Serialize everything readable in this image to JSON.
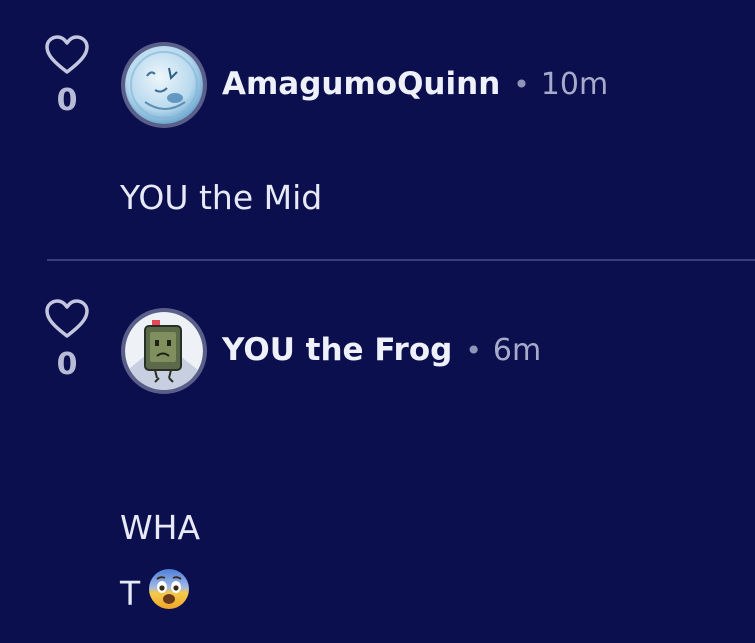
{
  "comments": [
    {
      "likes": "0",
      "username": "AmagumoQuinn",
      "separator": "•",
      "time": "10m",
      "lines": [
        "YOU the Mid"
      ]
    },
    {
      "likes": "0",
      "username": "YOU the Frog",
      "separator": "•",
      "time": "6m",
      "lines": [
        "WHA",
        "T"
      ]
    }
  ],
  "icons": {
    "like": "heart-icon",
    "emoji": "fearful-face-emoji"
  },
  "colors": {
    "background": "#0b0f4d",
    "text": "#e7e9f6",
    "muted": "#a6aacb",
    "divider": "#3a3f7a"
  }
}
